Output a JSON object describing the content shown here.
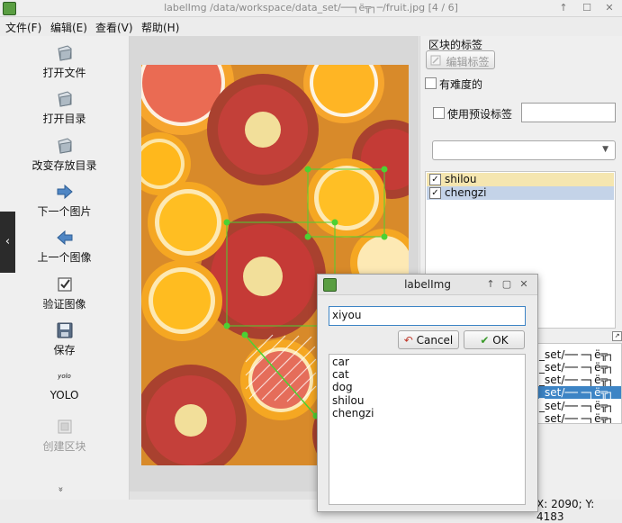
{
  "window": {
    "title": "labelImg /data/workspace/data_set/──┐ë╦┐─/fruit.jpg [4 / 6]",
    "controls": [
      "↑",
      "☐",
      "✕"
    ]
  },
  "menubar": {
    "items": [
      "文件(F)",
      "编辑(E)",
      "查看(V)",
      "帮助(H)"
    ]
  },
  "toolbar": {
    "items": [
      {
        "label": "打开文件",
        "icon": "folder-icon",
        "enabled": true
      },
      {
        "label": "打开目录",
        "icon": "folder-icon",
        "enabled": true
      },
      {
        "label": "改变存放目录",
        "icon": "folder-icon",
        "enabled": true
      },
      {
        "label": "下一个图片",
        "icon": "arrow-right-icon",
        "enabled": true
      },
      {
        "label": "上一个图像",
        "icon": "arrow-left-icon",
        "enabled": true
      },
      {
        "label": "验证图像",
        "icon": "checkbox-icon",
        "enabled": true
      },
      {
        "label": "保存",
        "icon": "save-icon",
        "enabled": true
      },
      {
        "label": "YOLO",
        "icon_text": "yolo",
        "enabled": true
      },
      {
        "label": "创建区块",
        "icon": "create-box-icon",
        "enabled": false
      }
    ],
    "more": "»"
  },
  "dock": {
    "title": "区块的标签",
    "edit_label_button": "编辑标签",
    "difficult_label": "有难度的",
    "use_default_label": "使用预设标签",
    "default_label_value": "",
    "combo_value": "",
    "labels": [
      {
        "text": "shilou",
        "checked": true,
        "highlight": "#f5e6b0"
      },
      {
        "text": "chengzi",
        "checked": true,
        "highlight": "#c4d3e8"
      }
    ]
  },
  "filelist": {
    "rows": [
      {
        "text": "_set/── ─┐ë╦┐",
        "selected": false
      },
      {
        "text": "_set/── ─┐ë╦┐",
        "selected": false
      },
      {
        "text": "_set/── ─┐ë╦┐",
        "selected": false
      },
      {
        "text": "_set/── ─┐ë╦┐",
        "selected": true
      },
      {
        "text": "_set/── ─┐ë╦┐",
        "selected": false
      },
      {
        "text": "_set/── ─┐ë╦┐",
        "selected": false
      }
    ]
  },
  "status": {
    "coords": "X: 2090; Y: 4183"
  },
  "dialog": {
    "title": "labelImg",
    "input_value": "xiyou",
    "cancel_label": "Cancel",
    "ok_label": "OK",
    "items": [
      "car",
      "cat",
      "dog",
      "shilou",
      "chengzi"
    ]
  },
  "colors": {
    "accent": "#3d84c5",
    "selection": "#3d84c5",
    "shape_vertex": "#4cd133"
  }
}
